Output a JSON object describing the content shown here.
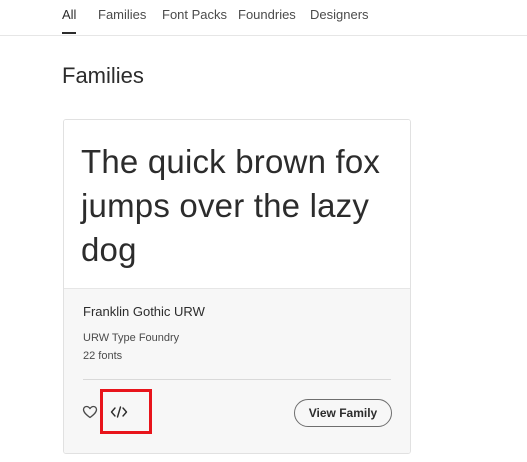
{
  "tabs": [
    {
      "label": "All",
      "active": true
    },
    {
      "label": "Families",
      "active": false
    },
    {
      "label": "Font Packs",
      "active": false
    },
    {
      "label": "Foundries",
      "active": false
    },
    {
      "label": "Designers",
      "active": false
    }
  ],
  "section": {
    "title": "Families"
  },
  "card": {
    "preview_text": "The quick brown fox jumps over the lazy dog",
    "family_name": "Franklin Gothic URW",
    "foundry": "URW Type Foundry",
    "font_count": "22 fonts",
    "view_family_label": "View Family",
    "icons": {
      "favorite": "heart-icon",
      "embed": "code-icon"
    },
    "highlight_color": "#e8141b"
  }
}
